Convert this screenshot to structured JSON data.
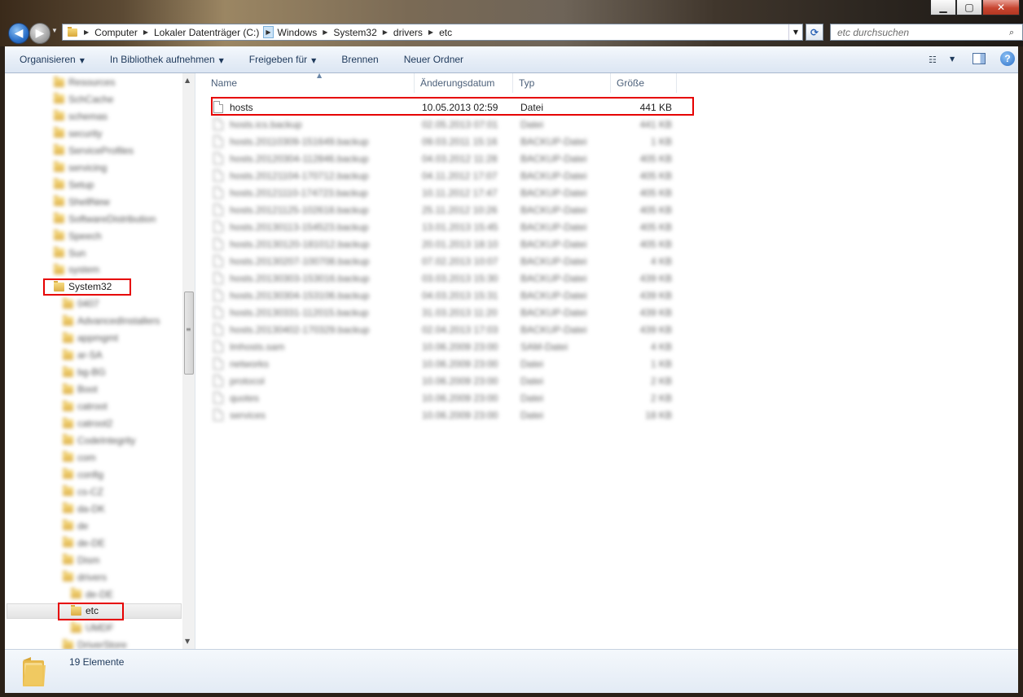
{
  "window": {
    "minimize": "▁",
    "maximize": "▢",
    "close": "✕"
  },
  "nav": {
    "back": "◀",
    "forward": "▶"
  },
  "address": {
    "crumbs": [
      "Computer",
      "Lokaler Datenträger (C:)",
      "Windows",
      "System32",
      "drivers",
      "etc"
    ]
  },
  "search": {
    "placeholder": "etc durchsuchen"
  },
  "toolbar": {
    "organize": "Organisieren",
    "library": "In Bibliothek aufnehmen",
    "share": "Freigeben für",
    "burn": "Brennen",
    "new_folder": "Neuer Ordner"
  },
  "columns": {
    "name": "Name",
    "date": "Änderungsdatum",
    "type": "Typ",
    "size": "Größe"
  },
  "tree": {
    "items": [
      {
        "label": "Resources",
        "blur": true
      },
      {
        "label": "SchCache",
        "blur": true
      },
      {
        "label": "schemas",
        "blur": true
      },
      {
        "label": "security",
        "blur": true
      },
      {
        "label": "ServiceProfiles",
        "blur": true
      },
      {
        "label": "servicing",
        "blur": true
      },
      {
        "label": "Setup",
        "blur": true
      },
      {
        "label": "ShellNew",
        "blur": true
      },
      {
        "label": "SoftwareDistribution",
        "blur": true
      },
      {
        "label": "Speech",
        "blur": true
      },
      {
        "label": "Sun",
        "blur": true
      },
      {
        "label": "system",
        "blur": true
      },
      {
        "label": "System32",
        "blur": false
      },
      {
        "label": "0407",
        "blur": true
      },
      {
        "label": "AdvancedInstallers",
        "blur": true
      },
      {
        "label": "appmgmt",
        "blur": true
      },
      {
        "label": "ar-SA",
        "blur": true
      },
      {
        "label": "bg-BG",
        "blur": true
      },
      {
        "label": "Boot",
        "blur": true
      },
      {
        "label": "catroot",
        "blur": true
      },
      {
        "label": "catroot2",
        "blur": true
      },
      {
        "label": "CodeIntegrity",
        "blur": true
      },
      {
        "label": "com",
        "blur": true
      },
      {
        "label": "config",
        "blur": true
      },
      {
        "label": "cs-CZ",
        "blur": true
      },
      {
        "label": "da-DK",
        "blur": true
      },
      {
        "label": "de",
        "blur": true
      },
      {
        "label": "de-DE",
        "blur": true
      },
      {
        "label": "Dism",
        "blur": true
      },
      {
        "label": "drivers",
        "blur": true
      },
      {
        "label": "de-DE",
        "blur": true
      },
      {
        "label": "etc",
        "blur": false
      },
      {
        "label": "UMDF",
        "blur": true
      },
      {
        "label": "DriverStore",
        "blur": true
      }
    ]
  },
  "files": [
    {
      "name": "hosts",
      "date": "10.05.2013 02:59",
      "type": "Datei",
      "size": "441 KB",
      "blur": false
    },
    {
      "name": "hosts.ics.backup",
      "date": "02.05.2013 07:01",
      "type": "Datei",
      "size": "441 KB",
      "blur": true
    },
    {
      "name": "hosts.20110309-151649.backup",
      "date": "09.03.2011 15:16",
      "type": "BACKUP-Datei",
      "size": "1 KB",
      "blur": true
    },
    {
      "name": "hosts.20120304-112846.backup",
      "date": "04.03.2012 11:28",
      "type": "BACKUP-Datei",
      "size": "405 KB",
      "blur": true
    },
    {
      "name": "hosts.20121104-170712.backup",
      "date": "04.11.2012 17:07",
      "type": "BACKUP-Datei",
      "size": "405 KB",
      "blur": true
    },
    {
      "name": "hosts.20121110-174723.backup",
      "date": "10.11.2012 17:47",
      "type": "BACKUP-Datei",
      "size": "405 KB",
      "blur": true
    },
    {
      "name": "hosts.20121125-102618.backup",
      "date": "25.11.2012 10:26",
      "type": "BACKUP-Datei",
      "size": "405 KB",
      "blur": true
    },
    {
      "name": "hosts.20130113-154523.backup",
      "date": "13.01.2013 15:45",
      "type": "BACKUP-Datei",
      "size": "405 KB",
      "blur": true
    },
    {
      "name": "hosts.20130120-181012.backup",
      "date": "20.01.2013 18:10",
      "type": "BACKUP-Datei",
      "size": "405 KB",
      "blur": true
    },
    {
      "name": "hosts.20130207-100708.backup",
      "date": "07.02.2013 10:07",
      "type": "BACKUP-Datei",
      "size": "4 KB",
      "blur": true
    },
    {
      "name": "hosts.20130303-153016.backup",
      "date": "03.03.2013 15:30",
      "type": "BACKUP-Datei",
      "size": "439 KB",
      "blur": true
    },
    {
      "name": "hosts.20130304-153106.backup",
      "date": "04.03.2013 15:31",
      "type": "BACKUP-Datei",
      "size": "439 KB",
      "blur": true
    },
    {
      "name": "hosts.20130331-112015.backup",
      "date": "31.03.2013 11:20",
      "type": "BACKUP-Datei",
      "size": "439 KB",
      "blur": true
    },
    {
      "name": "hosts.20130402-170329.backup",
      "date": "02.04.2013 17:03",
      "type": "BACKUP-Datei",
      "size": "439 KB",
      "blur": true
    },
    {
      "name": "lmhosts.sam",
      "date": "10.06.2009 23:00",
      "type": "SAM-Datei",
      "size": "4 KB",
      "blur": true
    },
    {
      "name": "networks",
      "date": "10.06.2009 23:00",
      "type": "Datei",
      "size": "1 KB",
      "blur": true
    },
    {
      "name": "protocol",
      "date": "10.06.2009 23:00",
      "type": "Datei",
      "size": "2 KB",
      "blur": true
    },
    {
      "name": "quotes",
      "date": "10.06.2009 23:00",
      "type": "Datei",
      "size": "2 KB",
      "blur": true
    },
    {
      "name": "services",
      "date": "10.06.2009 23:00",
      "type": "Datei",
      "size": "18 KB",
      "blur": true
    }
  ],
  "status": {
    "count": "19 Elemente"
  }
}
